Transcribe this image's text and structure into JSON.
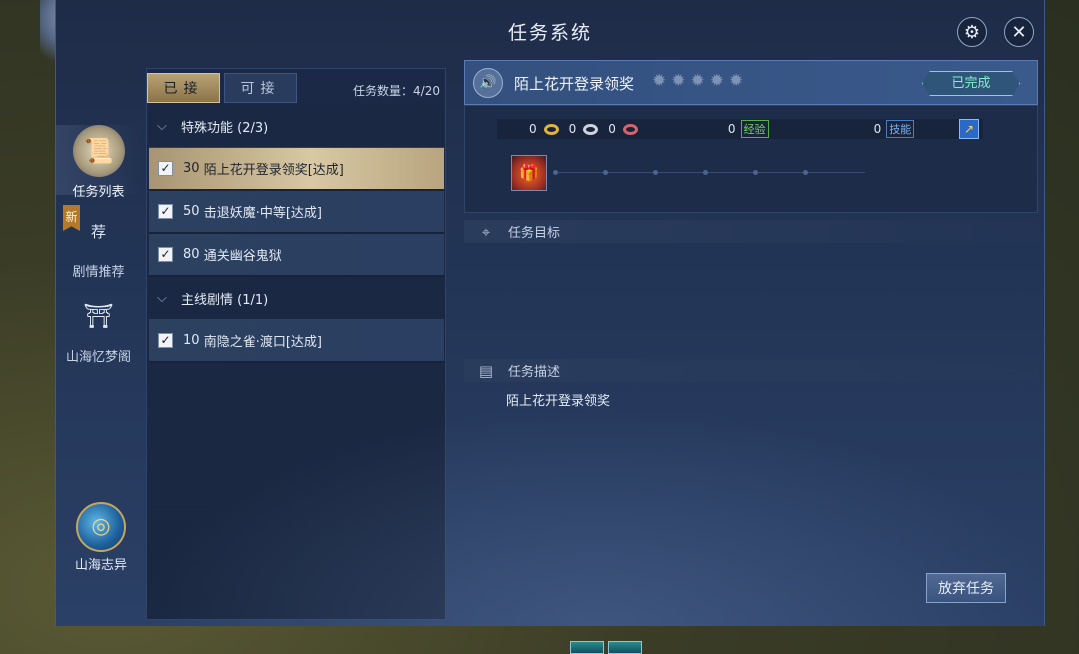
{
  "window": {
    "title": "任务系统"
  },
  "header_icons": {
    "settings": "gear-icon",
    "close": "close-icon"
  },
  "sidenav": {
    "items": [
      {
        "label": "任务列表",
        "icon": "scroll-icon",
        "active": true
      },
      {
        "label": "剧情推荐",
        "icon": "book-icon",
        "badge": "新",
        "badge_icon_text": "荐"
      },
      {
        "label": "山海忆梦阁",
        "icon": "pavilion-icon"
      }
    ],
    "bottom": {
      "label": "山海志异",
      "icon": "swirl-logo-icon"
    }
  },
  "list": {
    "tabs": [
      {
        "label": "已接",
        "active": true
      },
      {
        "label": "可接",
        "active": false
      }
    ],
    "count_label": "任务数量：4/20",
    "categories": [
      {
        "label": "特殊功能 (2/3)",
        "quests": [
          {
            "level": "30",
            "name": "陌上花开登录领奖[达成]",
            "checked": true,
            "selected": true
          },
          {
            "level": "50",
            "name": "击退妖魔·中等[达成]",
            "checked": true,
            "selected": false
          },
          {
            "level": "80",
            "name": "通关幽谷鬼狱",
            "checked": true,
            "selected": false
          }
        ]
      },
      {
        "label": "主线剧情 (1/1)",
        "quests": [
          {
            "level": "10",
            "name": "南隐之雀·渡口[达成]",
            "checked": true,
            "selected": false
          }
        ]
      }
    ]
  },
  "detail": {
    "quest_name": "陌上花开登录领奖",
    "star_count": 5,
    "status_label": "已完成",
    "rewards": {
      "gold": "0",
      "silver": "0",
      "red": "0",
      "exp_value": "0",
      "exp_label": "经验",
      "skill_value": "0",
      "skill_label": "技能"
    },
    "objective_label": "任务目标",
    "description_label": "任务描述",
    "description_text": "陌上花开登录领奖",
    "abandon_label": "放弃任务"
  },
  "colors": {
    "accent_gold": "#b9a274",
    "complete_green": "#7ff0cd",
    "exp_green": "#7ad35f",
    "skill_blue": "#7fb0ee"
  }
}
